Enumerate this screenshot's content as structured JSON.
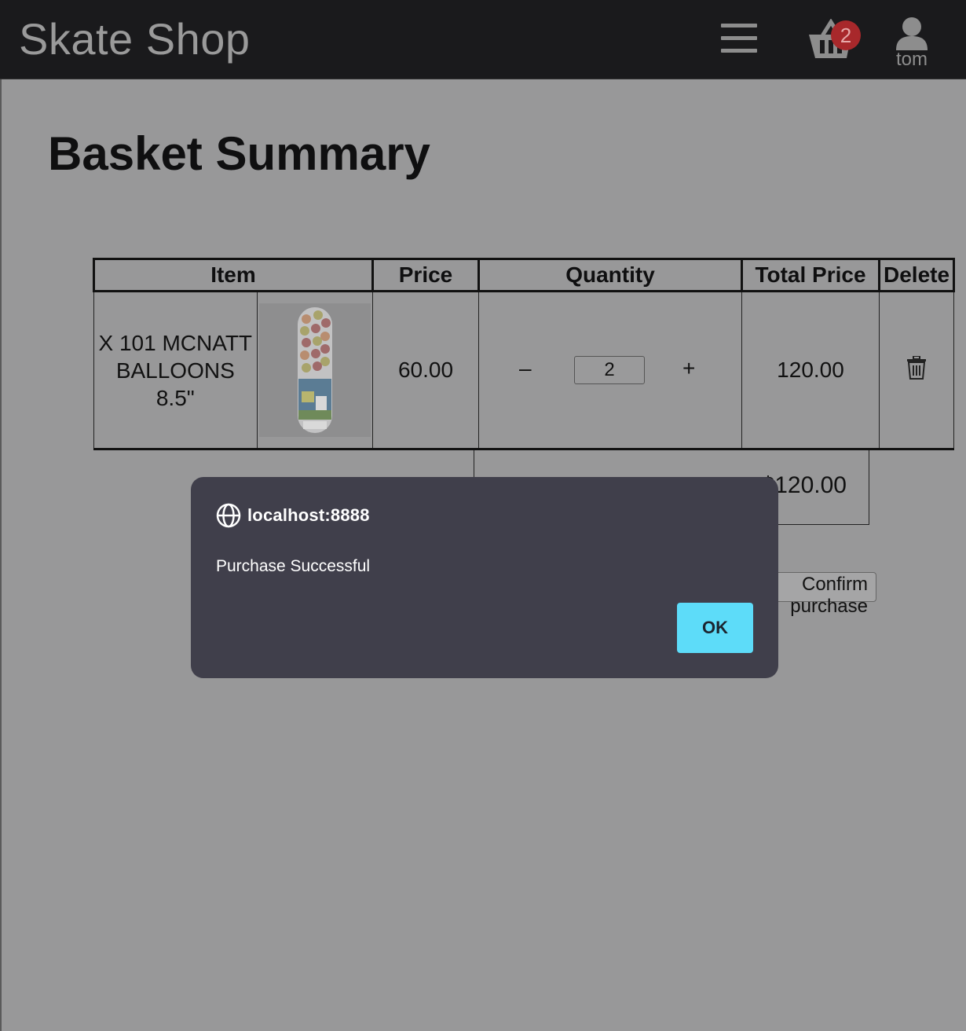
{
  "navbar": {
    "brand": "Skate Shop",
    "basket_count": "2",
    "username": "tom"
  },
  "page": {
    "title": "Basket Summary"
  },
  "table": {
    "headers": [
      "Item",
      "Price",
      "Quantity",
      "Total Price",
      "Delete"
    ],
    "rows": [
      {
        "item_name": "X 101 MCNATT BALLOONS 8.5\"",
        "price": "60.00",
        "quantity": "2",
        "minus_label": "–",
        "plus_label": "+",
        "total_price": "120.00"
      }
    ],
    "grand_total": "$120.00"
  },
  "confirm_button_label": "Confirm purchase",
  "dialog": {
    "origin": "localhost:8888",
    "message": "Purchase Successful",
    "ok_label": "OK"
  },
  "colors": {
    "overlay": "#989899",
    "navbar": "#1a1a1c",
    "dialog": "#403f4b",
    "ok_button": "#5ddcf9",
    "badge": "#a8282b"
  },
  "icons": [
    "menu-icon",
    "basket-icon",
    "user-icon",
    "trash-icon",
    "globe-icon"
  ]
}
